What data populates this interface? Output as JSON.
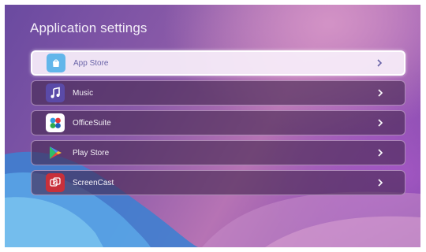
{
  "header": {
    "title": "Application settings"
  },
  "apps": [
    {
      "label": "App Store",
      "icon": "app-store-bag-icon",
      "selected": true
    },
    {
      "label": "Music",
      "icon": "music-note-icon",
      "selected": false
    },
    {
      "label": "OfficeSuite",
      "icon": "officesuite-icon",
      "selected": false
    },
    {
      "label": "Play Store",
      "icon": "play-store-icon",
      "selected": false
    },
    {
      "label": "ScreenCast",
      "icon": "screencast-icon",
      "selected": false
    }
  ],
  "colors": {
    "selected_label": "#6a64a8",
    "row_bg": "#46284f",
    "app_store_icon": "#62b6ea",
    "music_icon": "#5a4aa8",
    "officesuite_icon": "#ffffff",
    "screencast_icon": "#c8303a"
  }
}
